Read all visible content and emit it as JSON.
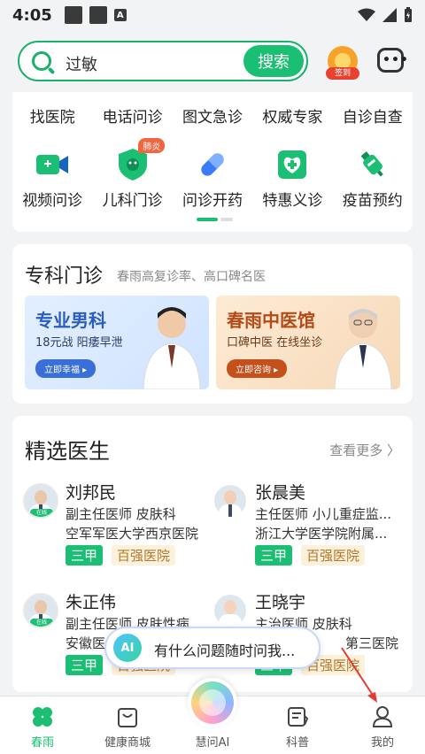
{
  "status_bar": {
    "time": "4:05",
    "a_icon": "A"
  },
  "search": {
    "placeholder": "过敏",
    "button": "搜索"
  },
  "header_icons": {
    "signin_label": "签到"
  },
  "quick_row1": [
    "找医院",
    "电话问诊",
    "图文急诊",
    "权威专家",
    "自诊自查"
  ],
  "quick_row2": [
    {
      "label": "视频问诊",
      "icon": "video-icon",
      "color": "#1bbf73"
    },
    {
      "label": "儿科门诊",
      "icon": "child-shield-icon",
      "color": "#1bbf73",
      "badge": "肺炎"
    },
    {
      "label": "问诊开药",
      "icon": "pill-icon",
      "color": "#3b7bf6"
    },
    {
      "label": "特惠义诊",
      "icon": "medical-cross-icon",
      "color": "#1bbf73"
    },
    {
      "label": "疫苗预约",
      "icon": "vaccine-icon",
      "color": "#1bbf73"
    }
  ],
  "specialty": {
    "title": "专科门诊",
    "subtitle": "春雨高复诊率、高口碑名医",
    "banners": [
      {
        "title": "专业男科",
        "sub": "18元战 阳痿早泄",
        "button": "立即幸福 ▸"
      },
      {
        "title": "春雨中医馆",
        "sub": "口碑中医 在线坐诊",
        "button": "立即咨询 ▸"
      }
    ]
  },
  "doctors": {
    "title": "精选医生",
    "more": "查看更多 〉",
    "avatar_tag": "在线",
    "list": [
      {
        "name": "刘邦民",
        "line1": "副主任医师 皮肤科",
        "line2": "空军军医大学西京医院",
        "tag1": "三甲",
        "tag2": "百强医院"
      },
      {
        "name": "张晨美",
        "line1": "主任医师 小儿重症监...",
        "line2": "浙江大学医学院附属...",
        "tag1": "三甲",
        "tag2": "百强医院"
      },
      {
        "name": "朱正伟",
        "line1": "副主任医师 皮肤性病",
        "line2": "安徽医",
        "tag1": "三甲",
        "tag2": "百强医院"
      },
      {
        "name": "王晓宇",
        "line1": "主治医师 皮肤科",
        "line2": "第三医院",
        "tag1": "三甲",
        "tag2": "百强医院"
      }
    ]
  },
  "ai_bubble": {
    "icon_text": "AI",
    "text": "有什么问题随时问我..."
  },
  "tabbar": [
    {
      "label": "春雨",
      "icon": "clover-icon",
      "active": true
    },
    {
      "label": "健康商城",
      "icon": "shopping-bag-icon",
      "active": false
    },
    {
      "label": "慧问AI",
      "icon": "ai-orb-icon",
      "active": false
    },
    {
      "label": "科普",
      "icon": "article-icon",
      "active": false
    },
    {
      "label": "我的",
      "icon": "user-icon",
      "active": false
    }
  ]
}
